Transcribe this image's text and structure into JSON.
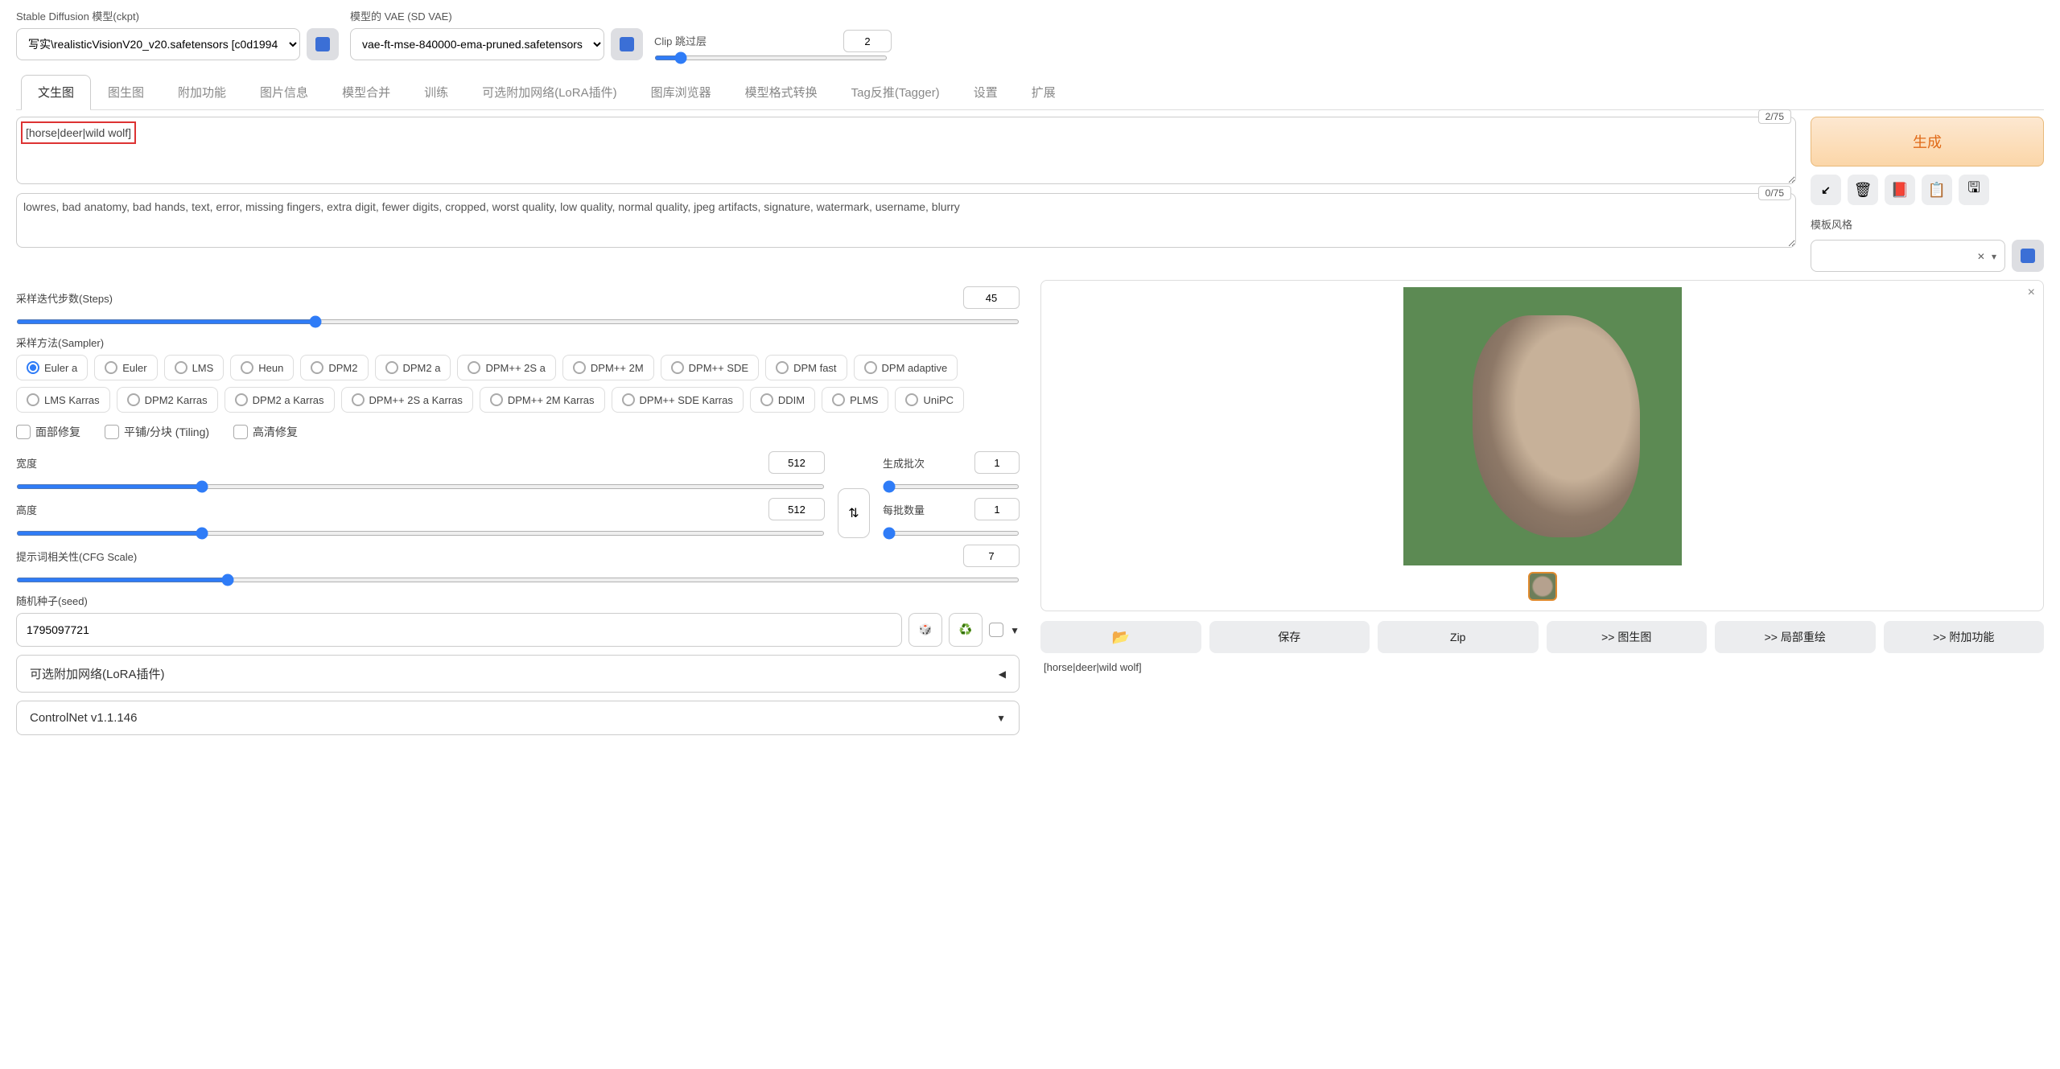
{
  "top": {
    "ckpt_label": "Stable Diffusion 模型(ckpt)",
    "ckpt_value": "写实\\realisticVisionV20_v20.safetensors [c0d1994",
    "vae_label": "模型的 VAE (SD VAE)",
    "vae_value": "vae-ft-mse-840000-ema-pruned.safetensors",
    "clip_label": "Clip 跳过层",
    "clip_value": 2
  },
  "tabs": [
    "文生图",
    "图生图",
    "附加功能",
    "图片信息",
    "模型合并",
    "训练",
    "可选附加网络(LoRA插件)",
    "图库浏览器",
    "模型格式转换",
    "Tag反推(Tagger)",
    "设置",
    "扩展"
  ],
  "active_tab": 0,
  "prompt": {
    "positive": "[horse|deer|wild wolf]",
    "positive_tokens": "2/75",
    "negative": "lowres, bad anatomy, bad hands, text, error, missing fingers, extra digit, fewer digits, cropped, worst quality, low quality, normal quality, jpeg artifacts, signature, watermark, username, blurry",
    "negative_tokens": "0/75"
  },
  "generate": "生成",
  "style_label": "模板风格",
  "steps": {
    "label": "采样迭代步数(Steps)",
    "value": 45,
    "min": 1,
    "max": 150
  },
  "sampler_label": "采样方法(Sampler)",
  "samplers": [
    "Euler a",
    "Euler",
    "LMS",
    "Heun",
    "DPM2",
    "DPM2 a",
    "DPM++ 2S a",
    "DPM++ 2M",
    "DPM++ SDE",
    "DPM fast",
    "DPM adaptive",
    "LMS Karras",
    "DPM2 Karras",
    "DPM2 a Karras",
    "DPM++ 2S a Karras",
    "DPM++ 2M Karras",
    "DPM++ SDE Karras",
    "DDIM",
    "PLMS",
    "UniPC"
  ],
  "sampler_selected": 0,
  "checks": {
    "face": "面部修复",
    "tiling": "平铺/分块 (Tiling)",
    "hires": "高清修复"
  },
  "width": {
    "label": "宽度",
    "value": 512,
    "min": 64,
    "max": 2048
  },
  "height": {
    "label": "高度",
    "value": 512,
    "min": 64,
    "max": 2048
  },
  "batch_count": {
    "label": "生成批次",
    "value": 1,
    "min": 1,
    "max": 100
  },
  "batch_size": {
    "label": "每批数量",
    "value": 1,
    "min": 1,
    "max": 8
  },
  "cfg": {
    "label": "提示词相关性(CFG Scale)",
    "value": 7,
    "min": 1,
    "max": 30
  },
  "seed": {
    "label": "随机种子(seed)",
    "value": "1795097721"
  },
  "accordions": {
    "lora": "可选附加网络(LoRA插件)",
    "controlnet": "ControlNet v1.1.146"
  },
  "output_caption": "[horse|deer|wild wolf]",
  "action_labels": {
    "save": "保存",
    "zip": "Zip",
    "img2img": ">> 图生图",
    "inpaint": ">> 局部重绘",
    "extras": ">> 附加功能"
  }
}
